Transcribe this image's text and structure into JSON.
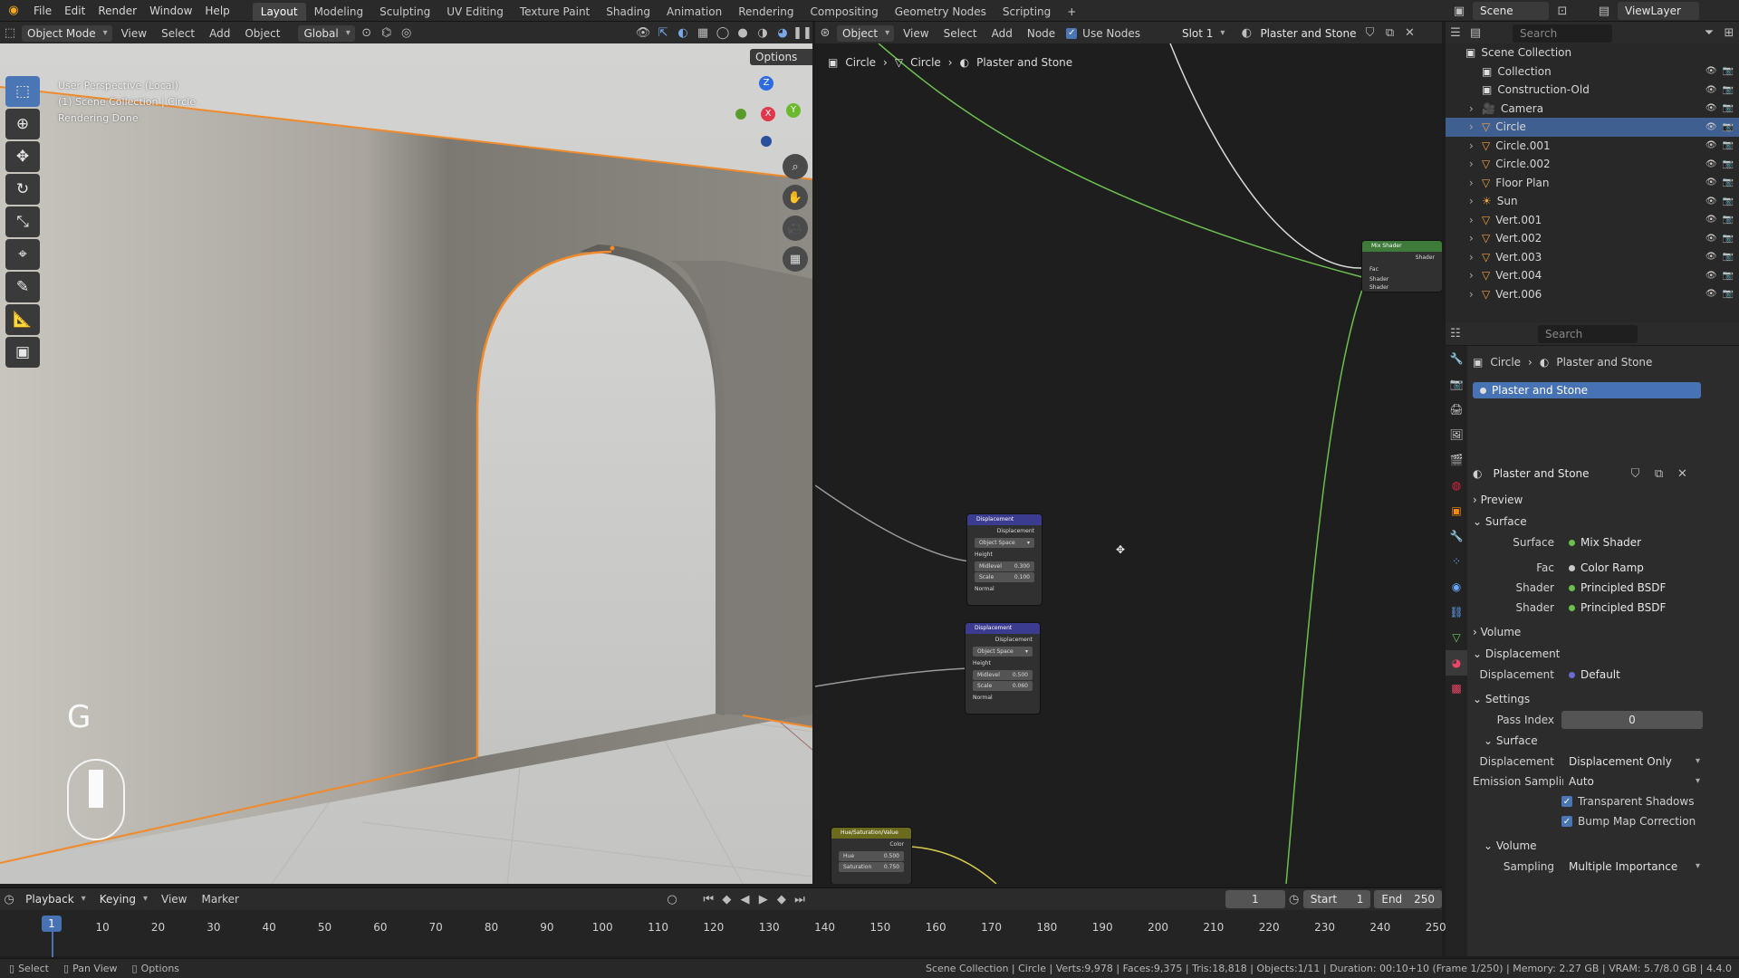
{
  "topbar": {
    "menus": [
      "File",
      "Edit",
      "Render",
      "Window",
      "Help"
    ],
    "workspaces": [
      "Layout",
      "Modeling",
      "Sculpting",
      "UV Editing",
      "Texture Paint",
      "Shading",
      "Animation",
      "Rendering",
      "Compositing",
      "Geometry Nodes",
      "Scripting"
    ],
    "active_workspace": "Layout",
    "add_tab": "+",
    "scene": "Scene",
    "view_layer": "ViewLayer"
  },
  "viewport": {
    "mode": "Object Mode",
    "menus": [
      "View",
      "Select",
      "Add",
      "Object"
    ],
    "orientation": "Global",
    "options": "Options",
    "info_line1": "User Perspective (Local)",
    "info_line2": "(1) Scene Collection | Circle",
    "info_line3": "Rendering Done",
    "key_hint": "G",
    "gizmo": {
      "x": "X",
      "y": "Y",
      "z": "Z"
    }
  },
  "node_editor": {
    "type": "Object",
    "menus": [
      "View",
      "Select",
      "Add",
      "Node"
    ],
    "use_nodes": "Use Nodes",
    "slot": "Slot 1",
    "material": "Plaster and Stone",
    "breadcrumb": [
      "Circle",
      "Circle",
      "Plaster and Stone"
    ],
    "nodes": {
      "mix": {
        "title": "Mix Shader",
        "out": "Shader",
        "in": [
          "Fac",
          "Shader",
          "Shader"
        ]
      },
      "disp1": {
        "title": "Displacement",
        "out": "Displacement",
        "space": "Object Space",
        "height": "Height",
        "midlevel_label": "Midlevel",
        "midlevel": "0.300",
        "scale_label": "Scale",
        "scale": "0.100",
        "normal": "Normal"
      },
      "disp2": {
        "title": "Displacement",
        "out": "Displacement",
        "space": "Object Space",
        "height": "Height",
        "midlevel_label": "Midlevel",
        "midlevel": "0.500",
        "scale_label": "Scale",
        "scale": "0.060",
        "normal": "Normal"
      },
      "hsv": {
        "title": "Hue/Saturation/Value",
        "out": "Color",
        "hue_label": "Hue",
        "hue": "0.500",
        "sat_label": "Saturation",
        "sat": "0.750"
      }
    }
  },
  "outliner": {
    "search_placeholder": "Search",
    "root": "Scene Collection",
    "items": [
      {
        "name": "Collection"
      },
      {
        "name": "Construction-Old"
      },
      {
        "name": "Camera"
      },
      {
        "name": "Circle"
      },
      {
        "name": "Circle.001"
      },
      {
        "name": "Circle.002"
      },
      {
        "name": "Floor Plan"
      },
      {
        "name": "Sun"
      },
      {
        "name": "Vert.001"
      },
      {
        "name": "Vert.002"
      },
      {
        "name": "Vert.003"
      },
      {
        "name": "Vert.004"
      },
      {
        "name": "Vert.006"
      }
    ]
  },
  "properties": {
    "search_placeholder": "Search",
    "breadcrumb_obj": "Circle",
    "breadcrumb_mat": "Plaster and Stone",
    "slot_name": "Plaster and Stone",
    "material_name": "Plaster and Stone",
    "preview": "Preview",
    "surface_section": "Surface",
    "surface_label": "Surface",
    "surface_value": "Mix Shader",
    "fac_label": "Fac",
    "fac_value": "Color Ramp",
    "shader_label": "Shader",
    "shader1_value": "Principled BSDF",
    "shader2_value": "Principled BSDF",
    "volume_section": "Volume",
    "displacement_section": "Displacement",
    "displacement_label": "Displacement",
    "displacement_value": "Default",
    "settings_section": "Settings",
    "pass_index_label": "Pass Index",
    "pass_index": "0",
    "sub_surface": "Surface",
    "disp_method_label": "Displacement",
    "disp_method": "Displacement Only",
    "emission_label": "Emission Sampling",
    "emission": "Auto",
    "transparent_shadows": "Transparent Shadows",
    "bump_map": "Bump Map Correction",
    "sub_volume": "Volume",
    "sampling_label": "Sampling",
    "sampling": "Multiple Importance"
  },
  "timeline": {
    "menus": [
      "Playback",
      "Keying",
      "View",
      "Marker"
    ],
    "current_frame": "1",
    "start_label": "Start",
    "start": "1",
    "end_label": "End",
    "end": "250",
    "marker": "1",
    "ticks": [
      "10",
      "20",
      "30",
      "40",
      "50",
      "60",
      "70",
      "80",
      "90",
      "100",
      "110",
      "120",
      "130",
      "140",
      "150",
      "160",
      "170",
      "180",
      "190",
      "200",
      "210",
      "220",
      "230",
      "240",
      "250"
    ]
  },
  "status": {
    "select": "Select",
    "pan": "Pan View",
    "options": "Options",
    "stats": "Scene Collection | Circle | Verts:9,978 | Faces:9,375 | Tris:18,818 | Objects:1/11 | Duration: 00:10+10 (Frame 1/250) | Memory: 2.27 GB | VRAM: 5.7/8.0 GB | 4.4.0"
  }
}
